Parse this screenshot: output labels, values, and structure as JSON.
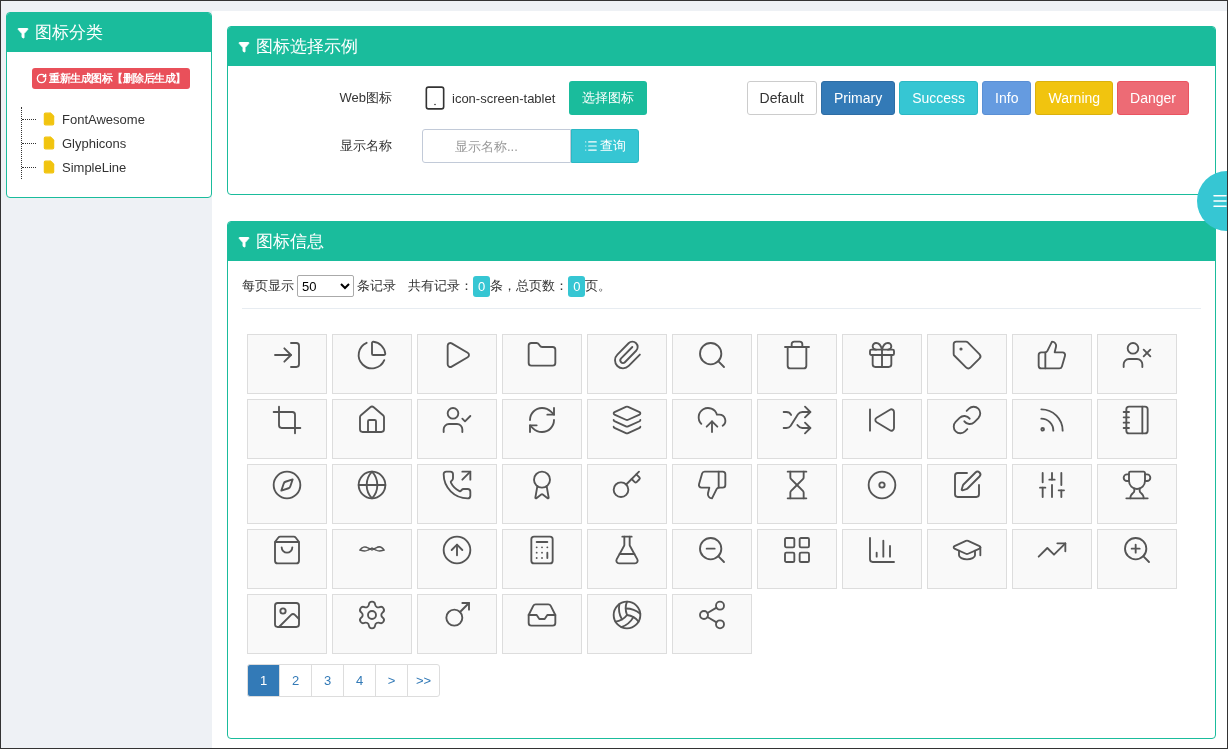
{
  "sidebar": {
    "title": "图标分类",
    "regenerate_button": "重新生成图标【删除后生成】",
    "tree": [
      {
        "label": "FontAwesome",
        "selected": false
      },
      {
        "label": "Glyphicons",
        "selected": false
      },
      {
        "label": "SimpleLine",
        "selected": false
      }
    ]
  },
  "example_panel": {
    "title": "图标选择示例",
    "web_icon_label": "Web图标",
    "web_icon_name": "icon-screen-tablet",
    "choose_button": "选择图标",
    "style_buttons": [
      {
        "label": "Default",
        "kind": "default"
      },
      {
        "label": "Primary",
        "kind": "primary"
      },
      {
        "label": "Success",
        "kind": "success"
      },
      {
        "label": "Info",
        "kind": "info"
      },
      {
        "label": "Warning",
        "kind": "warning"
      },
      {
        "label": "Danger",
        "kind": "danger"
      }
    ],
    "name_label": "显示名称",
    "name_field": {
      "placeholder": "显示名称..."
    },
    "query_button": "查询"
  },
  "info_panel": {
    "title": "图标信息",
    "per_page_label": "每页显示",
    "per_page_value": "50",
    "records_label": "条记录",
    "total_label": "共有记录：",
    "total_count": "0",
    "total_suffix": "条，总页数：",
    "page_count": "0",
    "page_suffix": "页。",
    "pagination": [
      {
        "label": "1",
        "selected": true
      },
      {
        "label": "2",
        "selected": false
      },
      {
        "label": "3",
        "selected": false
      },
      {
        "label": "4",
        "selected": false
      },
      {
        "label": ">",
        "selected": false
      },
      {
        "label": ">>",
        "selected": false
      }
    ]
  }
}
